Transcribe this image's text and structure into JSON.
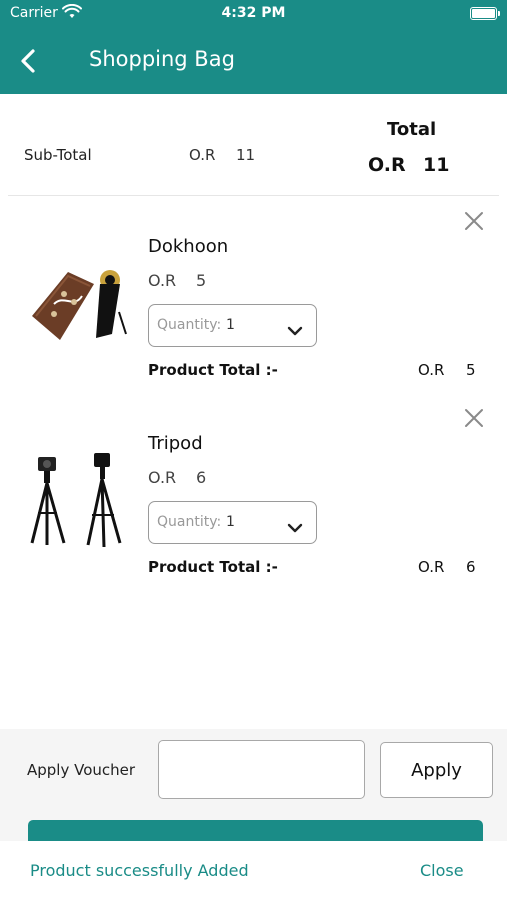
{
  "status_bar": {
    "carrier": "Carrier",
    "time": "4:32 PM",
    "wifi_icon": "wifi-icon",
    "battery_icon": "battery-icon"
  },
  "nav": {
    "title": "Shopping Bag",
    "back_icon": "chevron-left-icon"
  },
  "summary": {
    "subtotal_label": "Sub-Total",
    "subtotal_currency": "O.R",
    "subtotal_value": "11",
    "total_label": "Total",
    "total_currency": "O.R",
    "total_value": "11"
  },
  "items": [
    {
      "name": "Dokhoon",
      "price_currency": "O.R",
      "price_value": "5",
      "quantity_label": "Quantity:",
      "quantity_value": "1",
      "product_total_label": "Product Total :-",
      "product_total_currency": "O.R",
      "product_total_value": "5",
      "remove_icon": "close-icon"
    },
    {
      "name": "Tripod",
      "price_currency": "O.R",
      "price_value": "6",
      "quantity_label": "Quantity:",
      "quantity_value": "1",
      "product_total_label": "Product Total :-",
      "product_total_currency": "O.R",
      "product_total_value": "6",
      "remove_icon": "close-icon"
    }
  ],
  "voucher": {
    "label": "Apply Voucher",
    "input_value": "",
    "apply_label": "Apply"
  },
  "toast": {
    "message": "Product successfully Added",
    "close_label": "Close"
  },
  "colors": {
    "primary": "#1a8c87",
    "background": "#ffffff",
    "footer_background": "#f5f5f5"
  }
}
